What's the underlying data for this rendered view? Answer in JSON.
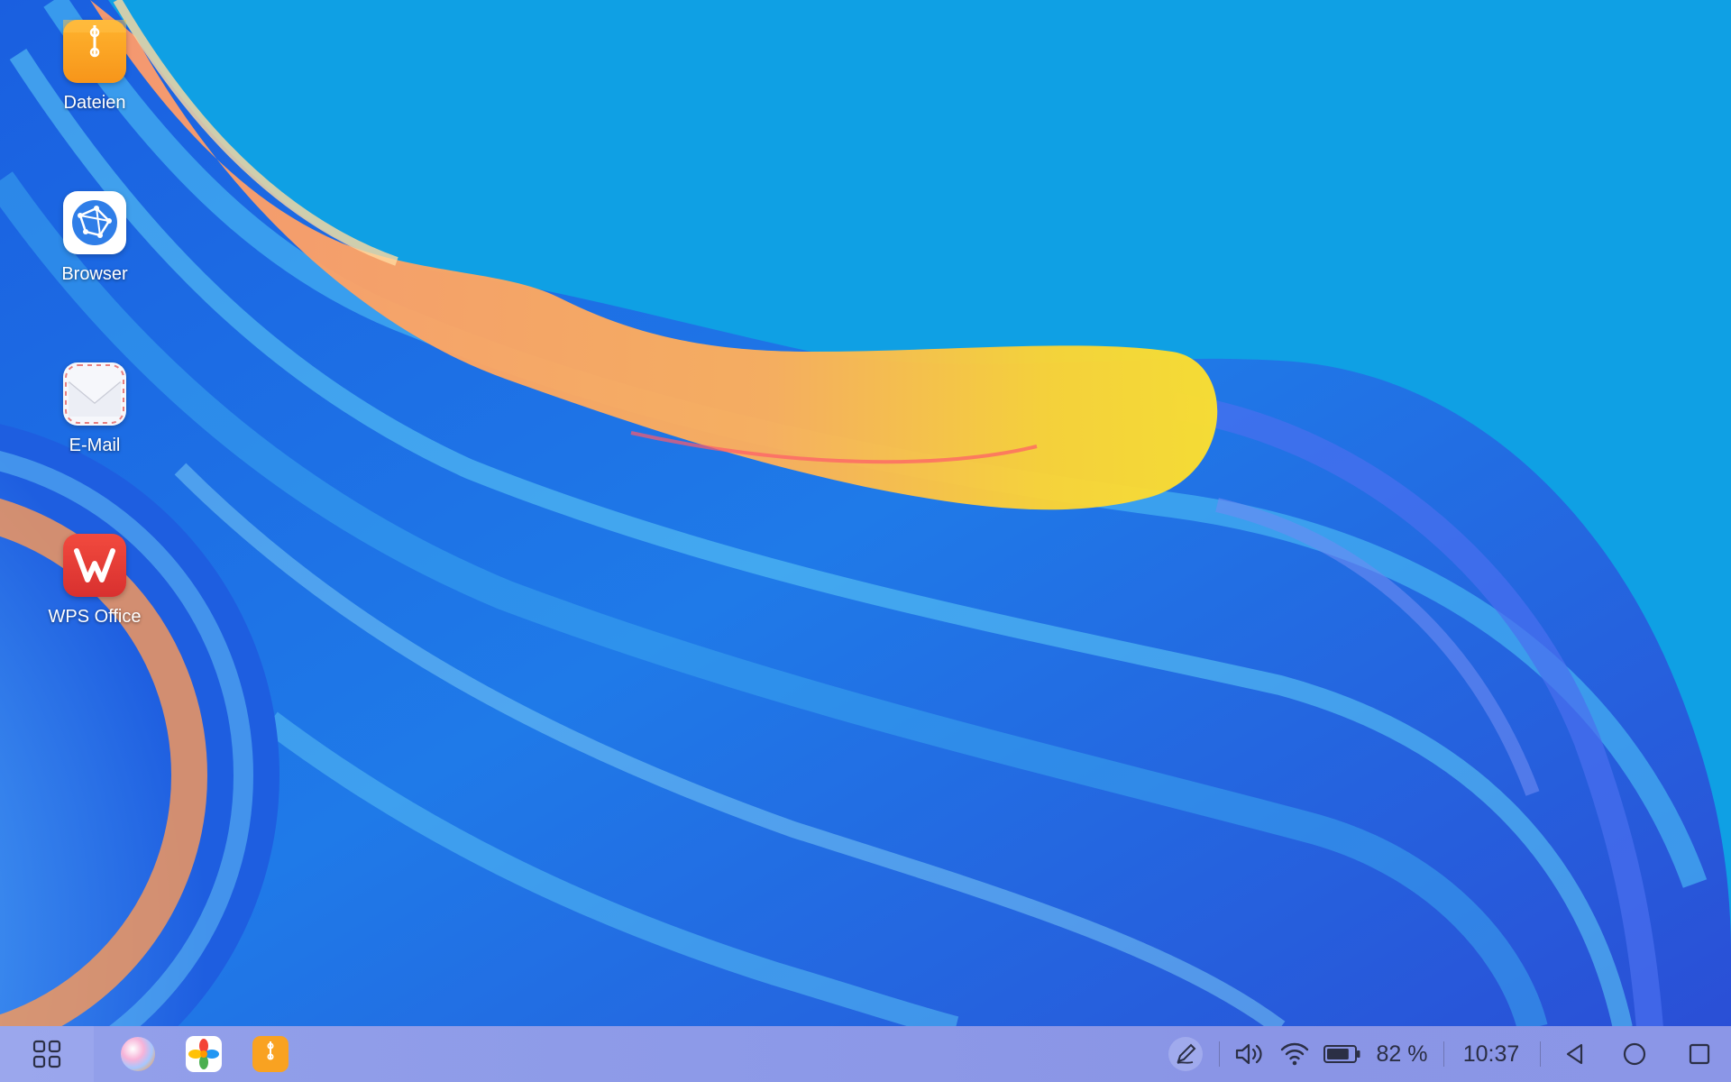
{
  "desktop": {
    "icons": [
      {
        "label": "Dateien",
        "icon": "files-icon",
        "color": "#f9a221"
      },
      {
        "label": "Browser",
        "icon": "browser-icon",
        "color": "#2f7ee8"
      },
      {
        "label": "E-Mail",
        "icon": "mail-icon",
        "color": "#ffffff"
      },
      {
        "label": "WPS Office",
        "icon": "wps-office-icon",
        "color": "#e53b36"
      }
    ]
  },
  "taskbar": {
    "launcher_icon": "app-grid-icon",
    "pinned_apps": [
      {
        "name": "celia-assistant-icon"
      },
      {
        "name": "gallery-icon"
      },
      {
        "name": "files-icon"
      }
    ],
    "status": {
      "stylus_icon": "stylus-icon",
      "volume_icon": "volume-icon",
      "wifi_icon": "wifi-icon",
      "battery_icon": "battery-icon",
      "battery_percent": "82 %",
      "battery_level": 0.82,
      "time": "10:37"
    },
    "nav": {
      "back_icon": "back-icon",
      "home_icon": "home-icon",
      "recents_icon": "recents-icon"
    }
  }
}
